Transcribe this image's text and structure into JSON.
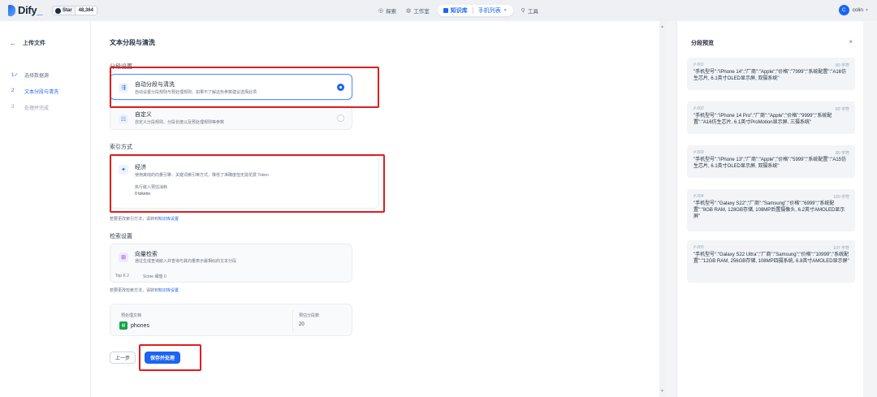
{
  "topbar": {
    "logo": "Dify",
    "github_label": "Star",
    "github_count": "48,364",
    "nav": {
      "explore": "探索",
      "studio": "工作室",
      "knowledge": "知识库",
      "dataset": "手机列表",
      "tools": "工具"
    },
    "user_initial": "C",
    "user_name": "colin"
  },
  "sidebar": {
    "back_label": "上传文件",
    "steps": [
      {
        "num": "1",
        "label": "选择数据源"
      },
      {
        "num": "2",
        "label": "文本分段与清洗"
      },
      {
        "num": "3",
        "label": "处理并完成"
      }
    ]
  },
  "main": {
    "title": "文本分段与清洗",
    "segment_section": "分段设置",
    "auto": {
      "title": "自动分段与清洗",
      "desc": "自动设置分段规则与预处理规则，如果不了解这些参数建议选择此项"
    },
    "custom": {
      "title": "自定义",
      "desc": "自定义分段规则、分段长度以及预处理规则等参数"
    },
    "index_section": "索引方式",
    "economy": {
      "title": "经济",
      "desc": "使用离线的向量引擎、关键词索引等方式，降低了准确度但无需花费 Token",
      "exec_label": "执行嵌入预估消耗",
      "tokens": "0 tokens"
    },
    "index_note_prefix": "若要更改索引方法，请转到",
    "index_note_link": "知识库设置",
    "retrieval_section": "检索设置",
    "vector": {
      "title": "向量检索",
      "desc": "通过生成查询嵌入并查询与其向量表示最相似的文本分段",
      "topk": "Top K  2",
      "score": "Score 阈值  0"
    },
    "retrieval_note_prefix": "若要更改检索方法，请转到",
    "retrieval_note_link": "知识库设置",
    "summary": {
      "doc_label": "预处理文档",
      "doc_name": "phones",
      "seg_label": "预估分段数",
      "seg_count": "20"
    },
    "prev_button": "上一步",
    "save_button": "保存并处理"
  },
  "preview": {
    "title": "分段预览",
    "cards": [
      {
        "id": "# 001",
        "chars": "80 字符",
        "text": "\"手机型号\":\"iPhone 14\";\"厂商\":\"Apple\";\"价格\":\"7999\";\"系统配置\":\"A16仿生芯片, 6.1英寸OLED显示屏, 双摄系统\""
      },
      {
        "id": "# 002",
        "chars": "89 字符",
        "text": "\"手机型号\":\"iPhone 14 Pro\";\"厂商\":\"Apple\";\"价格\":\"9999\";\"系统配置\":\"A16仿生芯片, 6.1英寸ProMotion显示屏, 三摄系统\""
      },
      {
        "id": "# 003",
        "chars": "80 字符",
        "text": "\"手机型号\":\"iPhone 13\";\"厂商\":\"Apple\";\"价格\":\"5999\";\"系统配置\":\"A15仿生芯片, 6.1英寸OLED显示屏, 双摄系统\""
      },
      {
        "id": "# 004",
        "chars": "100 字符",
        "text": "\"手机型号\":\"Galaxy S22\";\"厂商\":\"Samsung\";\"价格\":\"6999\";\"系统配置\":\"8GB RAM, 128GB存储, 108MP后置摄像头, 6.2英寸AMOLED显示屏\""
      },
      {
        "id": "# 005",
        "chars": "107 字符",
        "text": "\"手机型号\":\"Galaxy S22 Ultra\";\"厂商\":\"Samsung\";\"价格\":\"10999\";\"系统配置\":\"12GB RAM, 256GB存储, 108MP四摄系统, 6.8英寸AMOLED显示屏\""
      }
    ]
  },
  "colors": {
    "accent": "#1c64f2",
    "annotation": "#e11d1d"
  }
}
